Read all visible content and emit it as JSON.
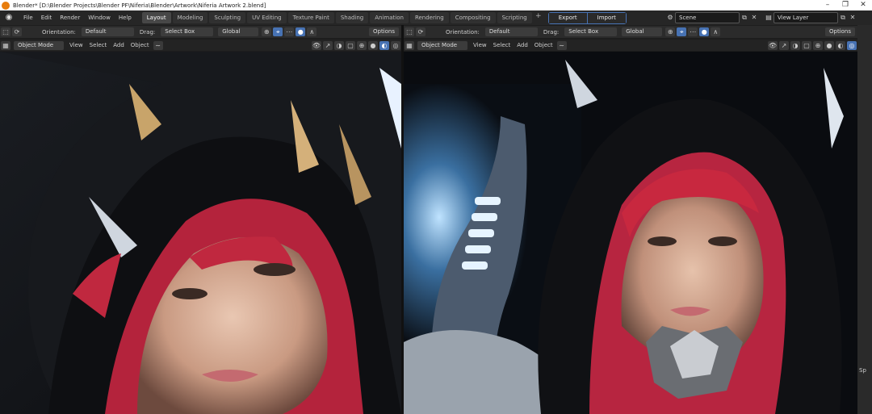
{
  "window": {
    "title": "Blender* [D:\\Blender Projects\\Blender PF\\Niferia\\Blender\\Artwork\\Niferia Artwork 2.blend]",
    "minimize_icon": "minimize-icon",
    "maximize_icon": "restore-icon",
    "close_icon": "close-icon"
  },
  "topbar": {
    "menu": [
      "File",
      "Edit",
      "Render",
      "Window",
      "Help"
    ],
    "workspaces": [
      "Layout",
      "Modeling",
      "Sculpting",
      "UV Editing",
      "Texture Paint",
      "Shading",
      "Animation",
      "Rendering",
      "Compositing",
      "Scripting"
    ],
    "active_workspace": "Layout",
    "add_workspace": "+",
    "export_label": "Export",
    "import_label": "Import",
    "scene_value": "Scene",
    "view_layer_value": "View Layer"
  },
  "viewport_left": {
    "orientation_label": "Orientation:",
    "orientation_value": "Default",
    "drag_label": "Drag:",
    "drag_value": "Select Box",
    "transform_value": "Global",
    "options_label": "Options",
    "mode_value": "Object Mode",
    "menus": [
      "View",
      "Select",
      "Add",
      "Object"
    ]
  },
  "viewport_right": {
    "orientation_label": "Orientation:",
    "orientation_value": "Default",
    "drag_label": "Drag:",
    "drag_value": "Select Box",
    "transform_value": "Global",
    "options_label": "Options",
    "mode_value": "Object Mode",
    "menus": [
      "View",
      "Select",
      "Add",
      "Object"
    ]
  },
  "sidebar": {
    "label": "Sp"
  },
  "colors": {
    "accent": "#4772b3",
    "hair": "#c0283f"
  }
}
